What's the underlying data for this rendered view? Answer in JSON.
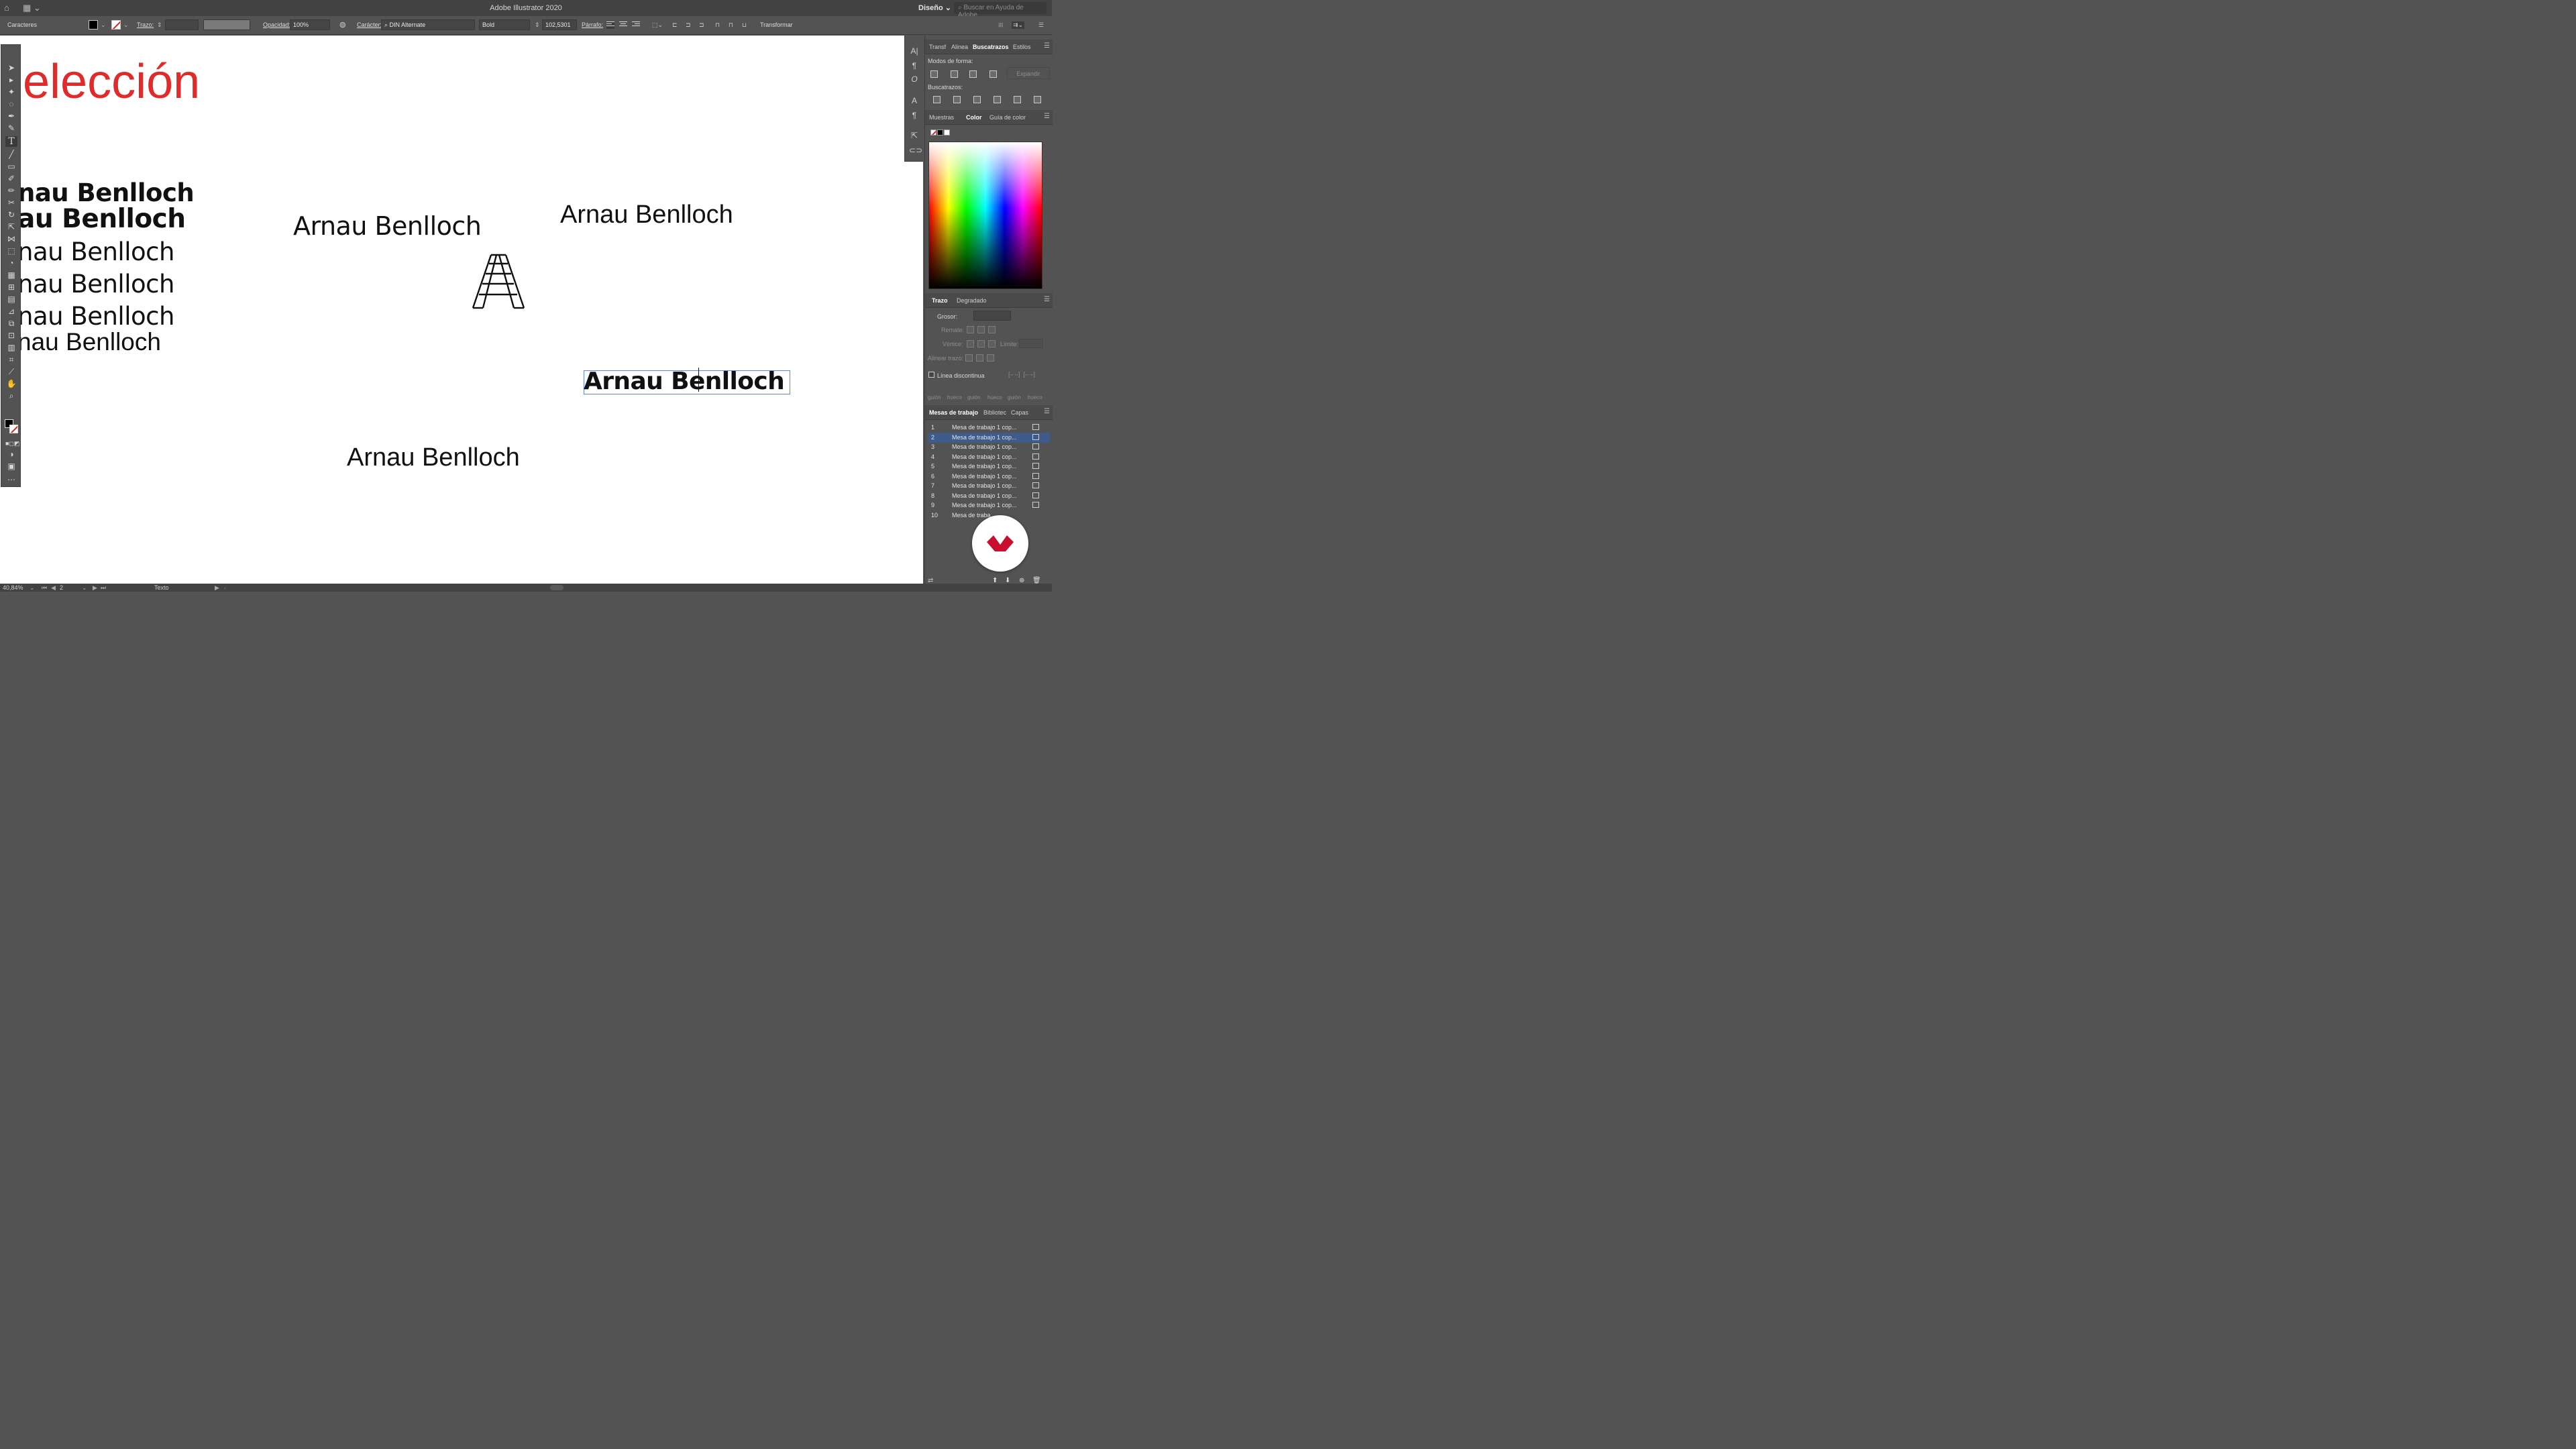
{
  "app": {
    "title": "Adobe Illustrator 2020",
    "workspace": "Diseño",
    "search_placeholder": "Buscar en Ayuda de Adobe"
  },
  "control": {
    "context": "Caracteres",
    "stroke_label": "Trazo:",
    "opacity_label": "Opacidad:",
    "opacity_value": "100%",
    "character_label": "Carácter:",
    "font_family": "DIN Alternate",
    "font_style": "Bold",
    "font_size": "102,5301",
    "paragraph_label": "Párrafo:",
    "transform_label": "Transformar"
  },
  "canvas": {
    "heading": "elección",
    "heading_color": "#e12a2a",
    "left_stack": [
      "nau Benlloch",
      "au Benlloch",
      "nau Benlloch",
      "nau Benlloch",
      "nau Benlloch",
      "nau Benlloch"
    ],
    "samples": [
      "Arnau Benlloch",
      "Arnau Benlloch",
      "Arnau Benlloch",
      "Arnau Benlloch"
    ]
  },
  "panels": {
    "top_tabs": [
      "Transf",
      "Alinea",
      "Buscatrazos",
      "Estilos"
    ],
    "shape_modes_label": "Modos de forma:",
    "expand_label": "Expandir",
    "pathfinders_label": "Buscatrazos:",
    "color_tabs": [
      "Muestras",
      "Color",
      "Guía de color"
    ],
    "stroke_tabs": [
      "Trazo",
      "Degradado"
    ],
    "weight_label": "Grosor:",
    "cap_label": "Remate:",
    "corner_label": "Vértice:",
    "limit_label": "Límite:",
    "align_stroke_label": "Alinear trazo:",
    "dashed_label": "Línea discontinua",
    "dash_labels": [
      "guión",
      "hueco",
      "guión",
      "hueco",
      "guión",
      "hueco"
    ],
    "bottom_tabs": [
      "Mesas de trabajo",
      "Bibliotec",
      "Capas"
    ],
    "artboards": [
      {
        "n": "1",
        "name": "Mesa de trabajo 1 cop..."
      },
      {
        "n": "2",
        "name": "Mesa de trabajo 1 cop..."
      },
      {
        "n": "3",
        "name": "Mesa de trabajo 1 cop..."
      },
      {
        "n": "4",
        "name": "Mesa de trabajo 1 cop..."
      },
      {
        "n": "5",
        "name": "Mesa de trabajo 1 cop..."
      },
      {
        "n": "6",
        "name": "Mesa de trabajo 1 cop..."
      },
      {
        "n": "7",
        "name": "Mesa de trabajo 1 cop..."
      },
      {
        "n": "8",
        "name": "Mesa de trabajo 1 cop..."
      },
      {
        "n": "9",
        "name": "Mesa de trabajo 1 cop..."
      },
      {
        "n": "10",
        "name": "Mesa de traba..."
      }
    ]
  },
  "status": {
    "zoom": "40,84%",
    "artboard_number": "2",
    "tool_name": "Texto"
  }
}
